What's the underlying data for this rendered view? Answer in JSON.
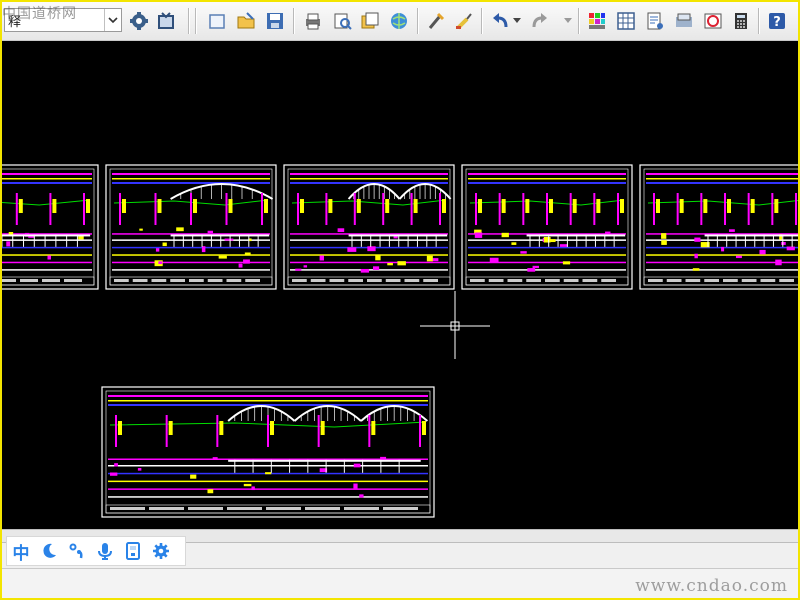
{
  "toolbar": {
    "layer_combo_text": "释",
    "watermark_top": "中国道桥网",
    "buttons": [
      "layer-properties-icon",
      "layer-state-icon",
      "new-drawing-icon",
      "open-file-icon",
      "save-icon",
      "plot-icon",
      "plot-preview-icon",
      "publish-icon",
      "web-publish-icon",
      "match-properties-icon",
      "brush-icon",
      "undo-icon",
      "redo-icon",
      "color-palette-icon",
      "table-icon",
      "properties-icon",
      "design-center-icon",
      "tool-palette-icon",
      "calculator-icon",
      "help-icon"
    ]
  },
  "ime_bar": {
    "lang_label": "中",
    "items": [
      "moon-icon",
      "punctuation-icon",
      "microphone-icon",
      "keyboard-icon",
      "gear-icon"
    ]
  },
  "footer": {
    "watermark": "www.cndao.com"
  },
  "colors": {
    "canvas": "#000000",
    "frame_border": "#f3e500",
    "accent": "#2a83e8"
  }
}
